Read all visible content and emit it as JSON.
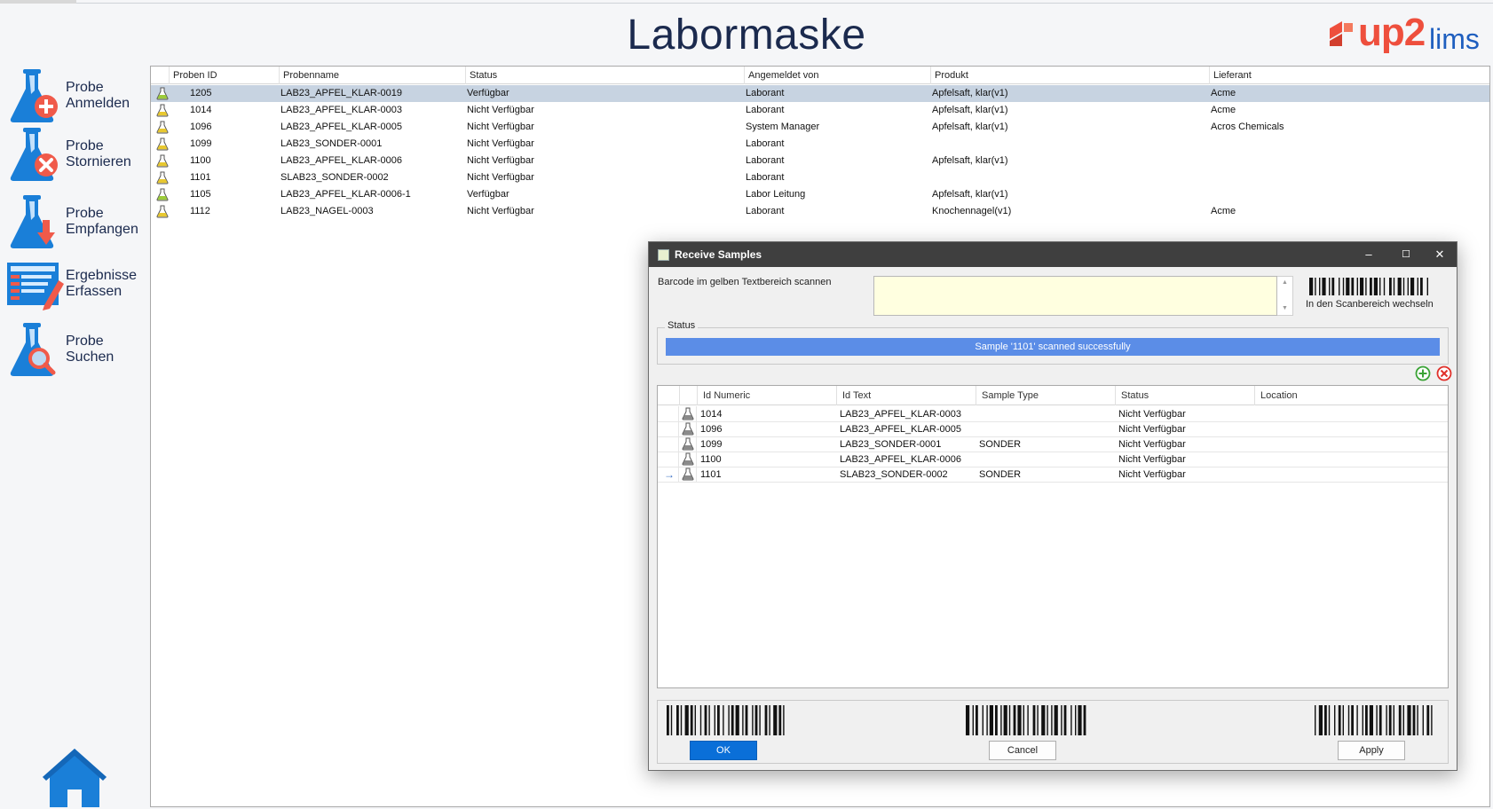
{
  "page": {
    "title": "Labormaske"
  },
  "logo": {
    "part1": "up2",
    "part2": "lims"
  },
  "colors": {
    "accent": "#0a6fd8",
    "logo_red": "#ee4f3d",
    "logo_blue": "#1f5fbf",
    "status_bar": "#5b8de7",
    "selected_row": "#c7d3e1",
    "scan_area": "#ffffe0"
  },
  "sidebar": {
    "items": [
      {
        "line1": "Probe",
        "line2": "Anmelden",
        "icon": "flask-add-icon"
      },
      {
        "line1": "Probe",
        "line2": "Stornieren",
        "icon": "flask-cancel-icon"
      },
      {
        "line1": "Probe",
        "line2": "Empfangen",
        "icon": "flask-receive-icon"
      },
      {
        "line1": "Ergebnisse",
        "line2": "Erfassen",
        "icon": "form-edit-icon"
      },
      {
        "line1": "Probe",
        "line2": "Suchen",
        "icon": "flask-search-icon"
      }
    ],
    "home_icon": "home-icon"
  },
  "grid": {
    "columns": [
      "Proben ID",
      "Probenname",
      "Status",
      "Angemeldet von",
      "Produkt",
      "Lieferant"
    ],
    "rows": [
      {
        "id": "1205",
        "name": "LAB23_APFEL_KLAR-0019",
        "status": "Verfügbar",
        "by": "Laborant",
        "product": "Apfelsaft, klar(v1)",
        "supplier": "Acme",
        "flask": "green",
        "selected": true
      },
      {
        "id": "1014",
        "name": "LAB23_APFEL_KLAR-0003",
        "status": "Nicht Verfügbar",
        "by": "Laborant",
        "product": "Apfelsaft, klar(v1)",
        "supplier": "Acme",
        "flask": "yellow",
        "selected": false
      },
      {
        "id": "1096",
        "name": "LAB23_APFEL_KLAR-0005",
        "status": "Nicht Verfügbar",
        "by": "System Manager",
        "product": "Apfelsaft, klar(v1)",
        "supplier": "Acros Chemicals",
        "flask": "yellow",
        "selected": false
      },
      {
        "id": "1099",
        "name": "LAB23_SONDER-0001",
        "status": "Nicht Verfügbar",
        "by": "Laborant",
        "product": "",
        "supplier": "",
        "flask": "yellow",
        "selected": false
      },
      {
        "id": "1100",
        "name": "LAB23_APFEL_KLAR-0006",
        "status": "Nicht Verfügbar",
        "by": "Laborant",
        "product": "Apfelsaft, klar(v1)",
        "supplier": "",
        "flask": "yellow",
        "selected": false
      },
      {
        "id": "1101",
        "name": "SLAB23_SONDER-0002",
        "status": "Nicht Verfügbar",
        "by": "Laborant",
        "product": "",
        "supplier": "",
        "flask": "yellow",
        "selected": false
      },
      {
        "id": "1105",
        "name": "LAB23_APFEL_KLAR-0006-1",
        "status": "Verfügbar",
        "by": "Labor Leitung",
        "product": "Apfelsaft, klar(v1)",
        "supplier": "",
        "flask": "green",
        "selected": false
      },
      {
        "id": "1112",
        "name": "LAB23_NAGEL-0003",
        "status": "Nicht Verfügbar",
        "by": "Laborant",
        "product": "Knochennagel(v1)",
        "supplier": "Acme",
        "flask": "yellow",
        "selected": false
      }
    ]
  },
  "dialog": {
    "title": "Receive Samples",
    "controls": {
      "minimize": "–",
      "maximize": "☐",
      "close": "✕"
    },
    "scan_label": "Barcode im gelben Textbereich scannen",
    "scan_value": "",
    "switch_label": "In den Scanbereich wechseln",
    "status_legend": "Status",
    "status_text": "Sample '1101' scanned successfully",
    "columns": [
      "Id Numeric",
      "Id Text",
      "Sample Type",
      "Status",
      "Location"
    ],
    "rows": [
      {
        "num": "1014",
        "text": "LAB23_APFEL_KLAR-0003",
        "type": "",
        "status": "Nicht Verfügbar",
        "location": "",
        "current": false
      },
      {
        "num": "1096",
        "text": "LAB23_APFEL_KLAR-0005",
        "type": "",
        "status": "Nicht Verfügbar",
        "location": "",
        "current": false
      },
      {
        "num": "1099",
        "text": "LAB23_SONDER-0001",
        "type": "SONDER",
        "status": "Nicht Verfügbar",
        "location": "",
        "current": false
      },
      {
        "num": "1100",
        "text": "LAB23_APFEL_KLAR-0006",
        "type": "",
        "status": "Nicht Verfügbar",
        "location": "",
        "current": false
      },
      {
        "num": "1101",
        "text": "SLAB23_SONDER-0002",
        "type": "SONDER",
        "status": "Nicht Verfügbar",
        "location": "",
        "current": true
      }
    ],
    "buttons": {
      "ok": "OK",
      "cancel": "Cancel",
      "apply": "Apply"
    }
  }
}
